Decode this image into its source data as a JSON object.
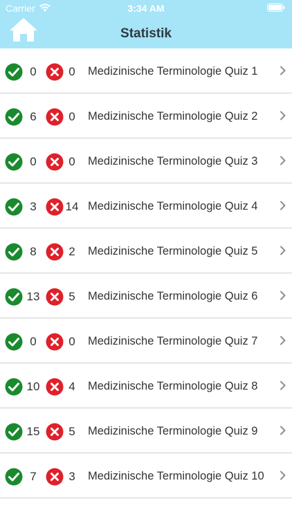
{
  "status": {
    "carrier": "Carrier",
    "time": "3:34 AM"
  },
  "header": {
    "title": "Statistik"
  },
  "icons": {
    "home": "home-icon",
    "correct": "check-circle-icon",
    "wrong": "x-circle-icon",
    "disclosure": "chevron-right-icon"
  },
  "colors": {
    "header_bg": "#a6e4f7",
    "correct_green": "#1a8a2e",
    "wrong_red": "#e0202a"
  },
  "quizzes": [
    {
      "correct": "0",
      "wrong": "0",
      "name": "Medizinische Terminologie Quiz 1"
    },
    {
      "correct": "6",
      "wrong": "0",
      "name": "Medizinische Terminologie Quiz 2"
    },
    {
      "correct": "0",
      "wrong": "0",
      "name": "Medizinische Terminologie Quiz 3"
    },
    {
      "correct": "3",
      "wrong": "14",
      "name": "Medizinische Terminologie Quiz 4"
    },
    {
      "correct": "8",
      "wrong": "2",
      "name": "Medizinische Terminologie Quiz 5"
    },
    {
      "correct": "13",
      "wrong": "5",
      "name": "Medizinische Terminologie Quiz 6"
    },
    {
      "correct": "0",
      "wrong": "0",
      "name": "Medizinische Terminologie Quiz 7"
    },
    {
      "correct": "10",
      "wrong": "4",
      "name": "Medizinische Terminologie Quiz 8"
    },
    {
      "correct": "15",
      "wrong": "5",
      "name": "Medizinische Terminologie Quiz 9"
    },
    {
      "correct": "7",
      "wrong": "3",
      "name": "Medizinische Terminologie Quiz 10"
    }
  ]
}
